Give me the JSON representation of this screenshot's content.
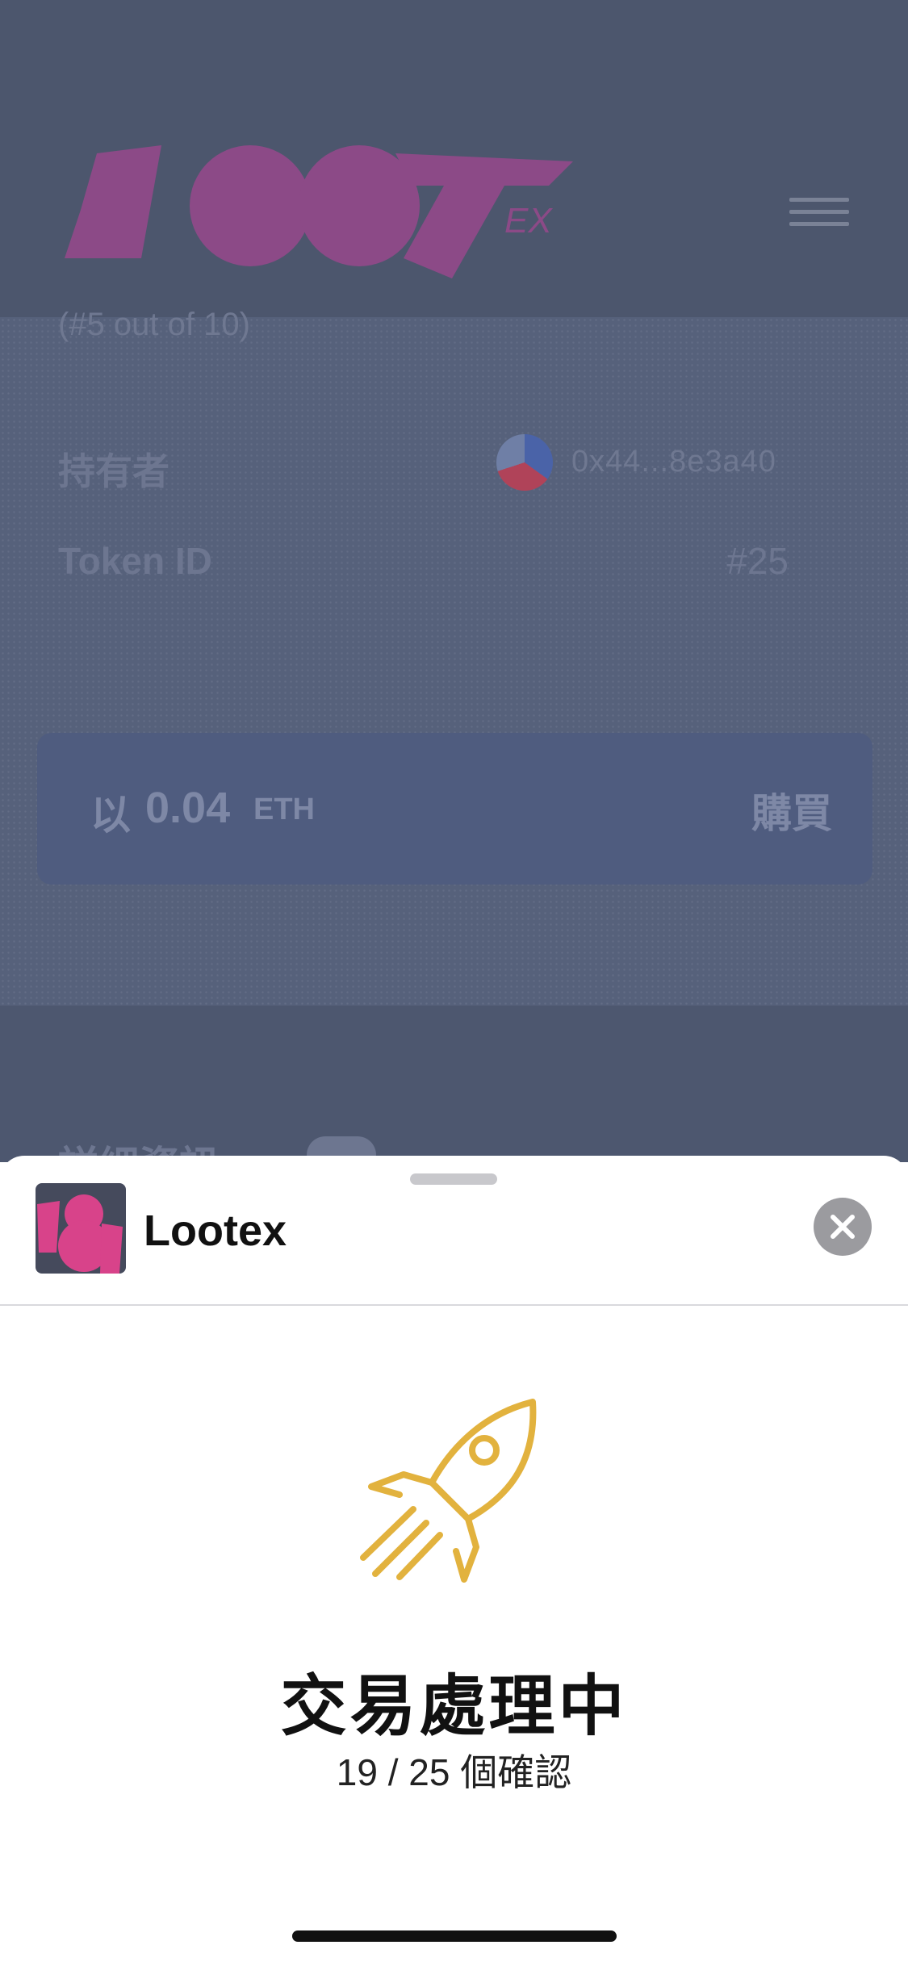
{
  "app": {
    "logo_text": "LOOTEX",
    "colors": {
      "brand_pink": "#d8438a",
      "accent_gold": "#e2b23e",
      "dim_bg": "#4d576f"
    }
  },
  "nft_detail": {
    "edition_text": "(#5 out of 10)",
    "owner_label": "持有者",
    "owner_address": "0x44...8e3a40",
    "token_id_label": "Token ID",
    "token_id_value": "#25",
    "buy_prefix": "以",
    "buy_price": "0.04",
    "buy_currency": "ETH",
    "buy_action": "購買",
    "details_heading": "詳細資訊"
  },
  "sheet": {
    "app_name": "Lootex",
    "status_title": "交易處理中",
    "confirmations_text": "19 / 25 個確認",
    "icons": {
      "close": "close-icon",
      "status": "rocket-icon",
      "app": "lootex-app-icon"
    }
  }
}
